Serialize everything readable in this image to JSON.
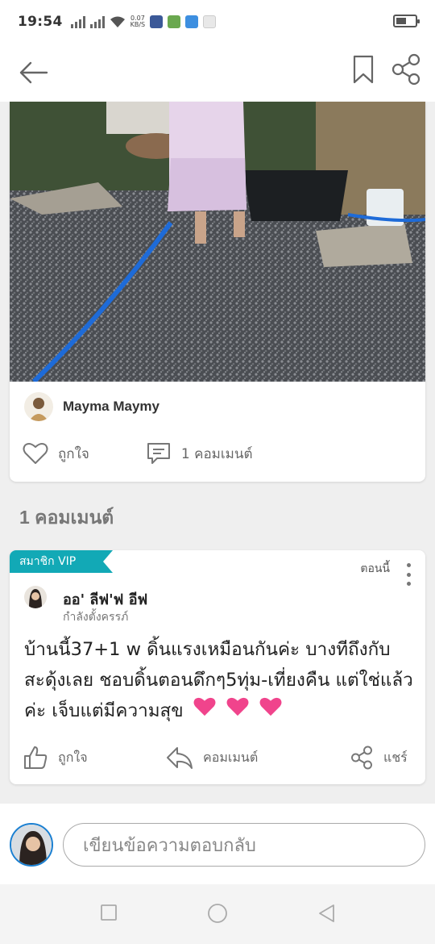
{
  "status_bar": {
    "time": "19:54",
    "speed_value": "0.07",
    "speed_unit": "KB/S"
  },
  "app_bar": {
    "back_icon": "arrow-left-icon",
    "bookmark_icon": "bookmark-icon",
    "share_icon": "share-icon"
  },
  "post": {
    "author_name": "Mayma Maymy",
    "like_label": "ถูกใจ",
    "comment_label": "1 คอมเมนต์"
  },
  "comments_heading": "1 คอมเมนต์",
  "comment": {
    "badge": "สมาชิก VIP",
    "time": "ตอนนี้",
    "author_name": "ออ' ลีฟ'ฟ อีฟ",
    "author_status": "กำลังตั้งครรภ์",
    "body": "บ้านนี้37+1 w ดิ้นแรงเหมือนกันค่ะ บางทีถึงกับสะดุ้งเลย ชอบดิ้นตอนดึกๆ5ทุ่ม-เที่ยงคืน แต่ใช่แล้วค่ะ เจ็บแต่มีความสุข",
    "like_label": "ถูกใจ",
    "comment_label": "คอมเมนต์",
    "share_label": "แชร์",
    "heart_color": "#f0448c"
  },
  "reply": {
    "placeholder": "เขียนข้อความตอบกลับ"
  },
  "colors": {
    "vip_teal": "#12a9b6",
    "avatar_ring": "#1a7fd1",
    "icon_gray": "#7a7a7a"
  }
}
